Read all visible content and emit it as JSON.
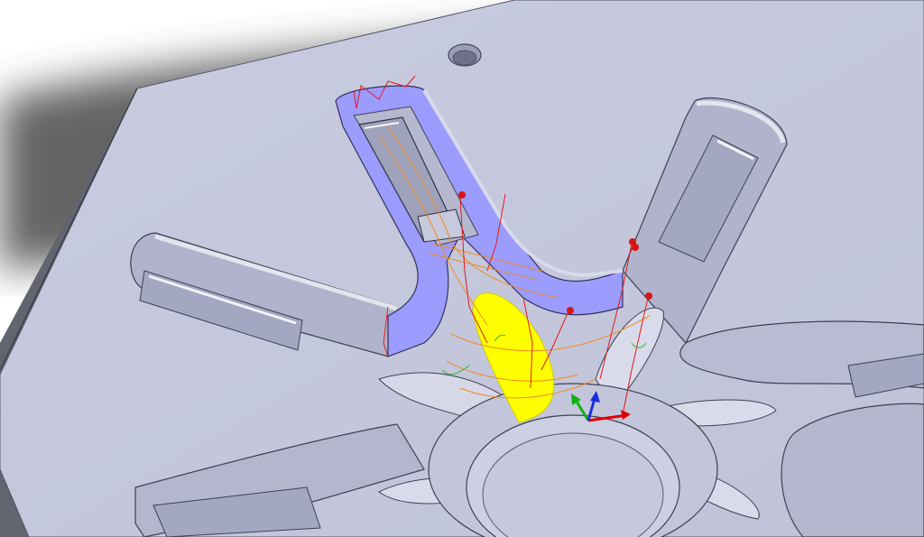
{
  "viewport": {
    "view": "cad-3d-viewport",
    "icons": [
      "origin-triad-icon",
      "toolpath-point-marker-icon"
    ]
  },
  "colors": {
    "background": "#ffffff",
    "body_face": "#c6c9dc",
    "body_side": "#5c5e69",
    "pocket_floor": "#b3b6cf",
    "selected_face": "#9c9cff",
    "highlighted_face": "#ffff00",
    "toolpath_red": "#e01b1b",
    "toolpath_orange": "#ef8a1f",
    "toolpath_green": "#2db52d",
    "point_marker": "#d81414",
    "axis_x": "#e00000",
    "axis_y": "#12b012",
    "axis_z": "#1830e0"
  }
}
